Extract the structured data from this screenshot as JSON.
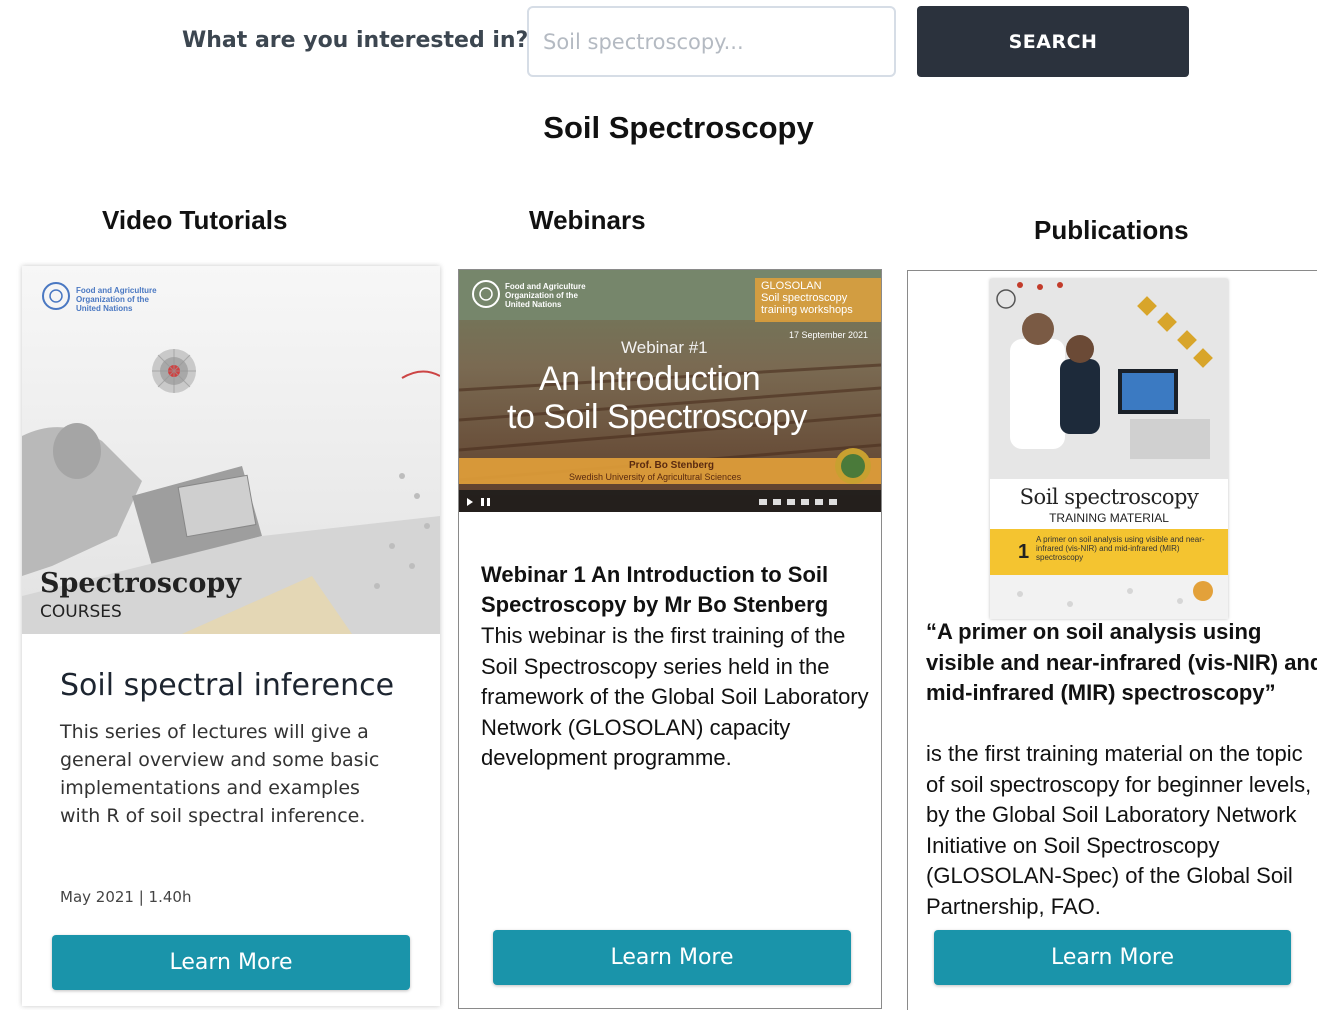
{
  "search": {
    "question": "What are you interested in?",
    "placeholder": "Soil spectroscopy...",
    "button": "SEARCH"
  },
  "page_title": "Soil Spectroscopy",
  "columns": {
    "video": "Video Tutorials",
    "webinars": "Webinars",
    "publications": "Publications"
  },
  "video_card": {
    "thumb_brand": "Spectroscopy",
    "thumb_sub": "COURSES",
    "org_lines": [
      "Food and Agriculture",
      "Organization of the",
      "United Nations"
    ],
    "title": "Soil spectral inference",
    "description": "This series of lectures will give a general overview and some basic implementations and examples with R of soil spectral inference.",
    "meta": "May 2021 | 1.40h",
    "button": "Learn More"
  },
  "webinar_card": {
    "thumb_org_lines": [
      "Food and Agriculture",
      "Organization of the",
      "United Nations"
    ],
    "thumb_badge_lines": [
      "GLOSOLAN",
      "Soil spectroscopy",
      "training workshops"
    ],
    "thumb_date": "17 September 2021",
    "thumb_kicker": "Webinar #1",
    "thumb_title_1": "An Introduction",
    "thumb_title_2": "to Soil Spectroscopy",
    "thumb_presenter": "Prof. Bo Stenberg",
    "thumb_affiliation": "Swedish University of Agricultural Sciences",
    "title": "Webinar 1 An Introduction to Soil Spectroscopy by Mr Bo Stenberg",
    "description": "This webinar is the first training of the Soil Spectroscopy series held in the framework of the Global Soil Laboratory Network (GLOSOLAN) capacity development programme.",
    "button": "Learn More"
  },
  "publication_card": {
    "cover_title": "Soil spectroscopy",
    "cover_sub": "TRAINING MATERIAL",
    "cover_num": "1",
    "cover_desc": "A primer on soil analysis using visible and near-infrared (vis-NIR) and mid-infrared (MIR) spectroscopy",
    "title": "“A primer on soil analysis using visible and near-infrared (vis-NIR) and mid-infrared (MIR) spectroscopy”",
    "description": "is the first training material on the topic of soil spectroscopy for beginner levels, by the Global Soil Laboratory Network Initiative on Soil Spectroscopy (GLOSOLAN-Spec) of the Global Soil Partnership, FAO.",
    "button": "Learn More"
  },
  "colors": {
    "dark_button": "#2b323d",
    "teal_button": "#1a94aa",
    "accent_yellow": "#f4c430",
    "accent_orange": "#e3a13a"
  }
}
